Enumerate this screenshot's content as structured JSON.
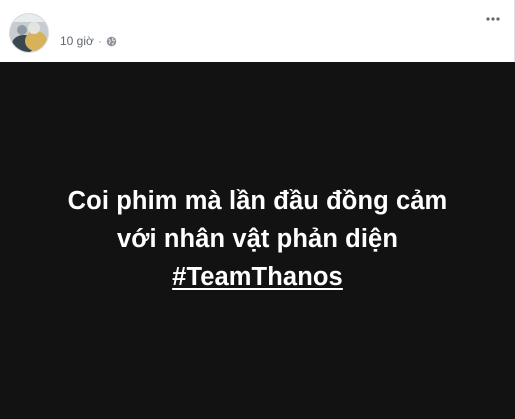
{
  "post": {
    "timestamp": "10 giờ",
    "separator": "·",
    "privacy_icon": "globe-icon",
    "more_icon": "more-options-icon"
  },
  "image": {
    "background_color": "#121212",
    "text_color": "#ffffff",
    "lines": [
      "Coi phim mà lần đầu đồng cảm",
      "với nhân vật phản diện",
      "#TeamThanos"
    ]
  }
}
